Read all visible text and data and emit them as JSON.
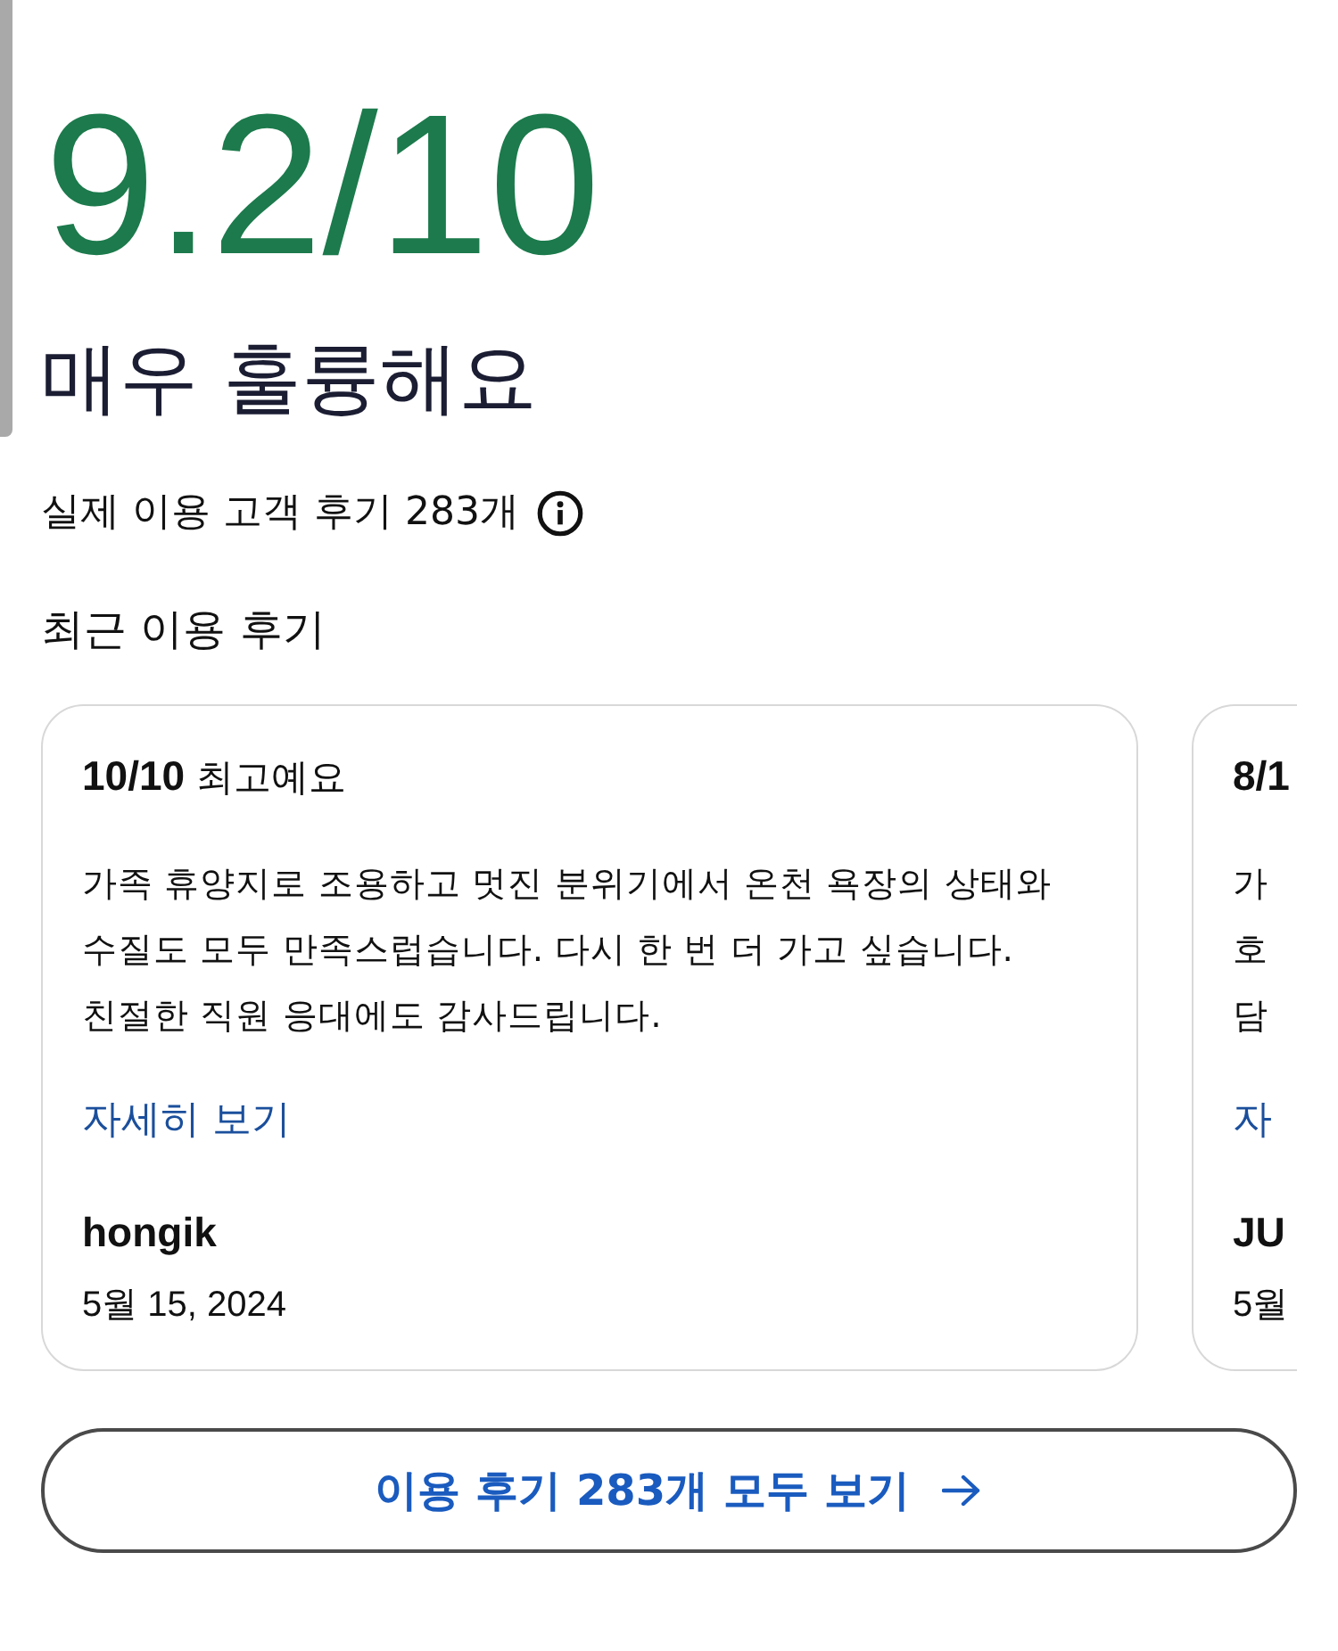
{
  "score": {
    "value": "9.2/10",
    "rating_label": "매우 훌륭해요"
  },
  "review_count": {
    "text": "실제 이용 고객 후기 283개"
  },
  "section_title": "최근 이용 후기",
  "reviews": [
    {
      "title": "**10/10** 최고예요",
      "body": "가족 휴양지로 조용하고 멋진 분위기에서 온천 욕장의 상태와\n수질도 모두 만족스럽습니다. 다시 한 번 더 가고 싶습니다.\n친절한 직원 응대에도 감사드립니다.",
      "link": "자세히 보기",
      "author": "hongik",
      "date": "5월 15, 2024"
    },
    {
      "title": "**8/1**",
      "body": "가\n호\n담",
      "link": "자",
      "author": "JU",
      "date": "5월"
    }
  ],
  "button": {
    "label": "이용 후기 283개 모두 보기"
  }
}
